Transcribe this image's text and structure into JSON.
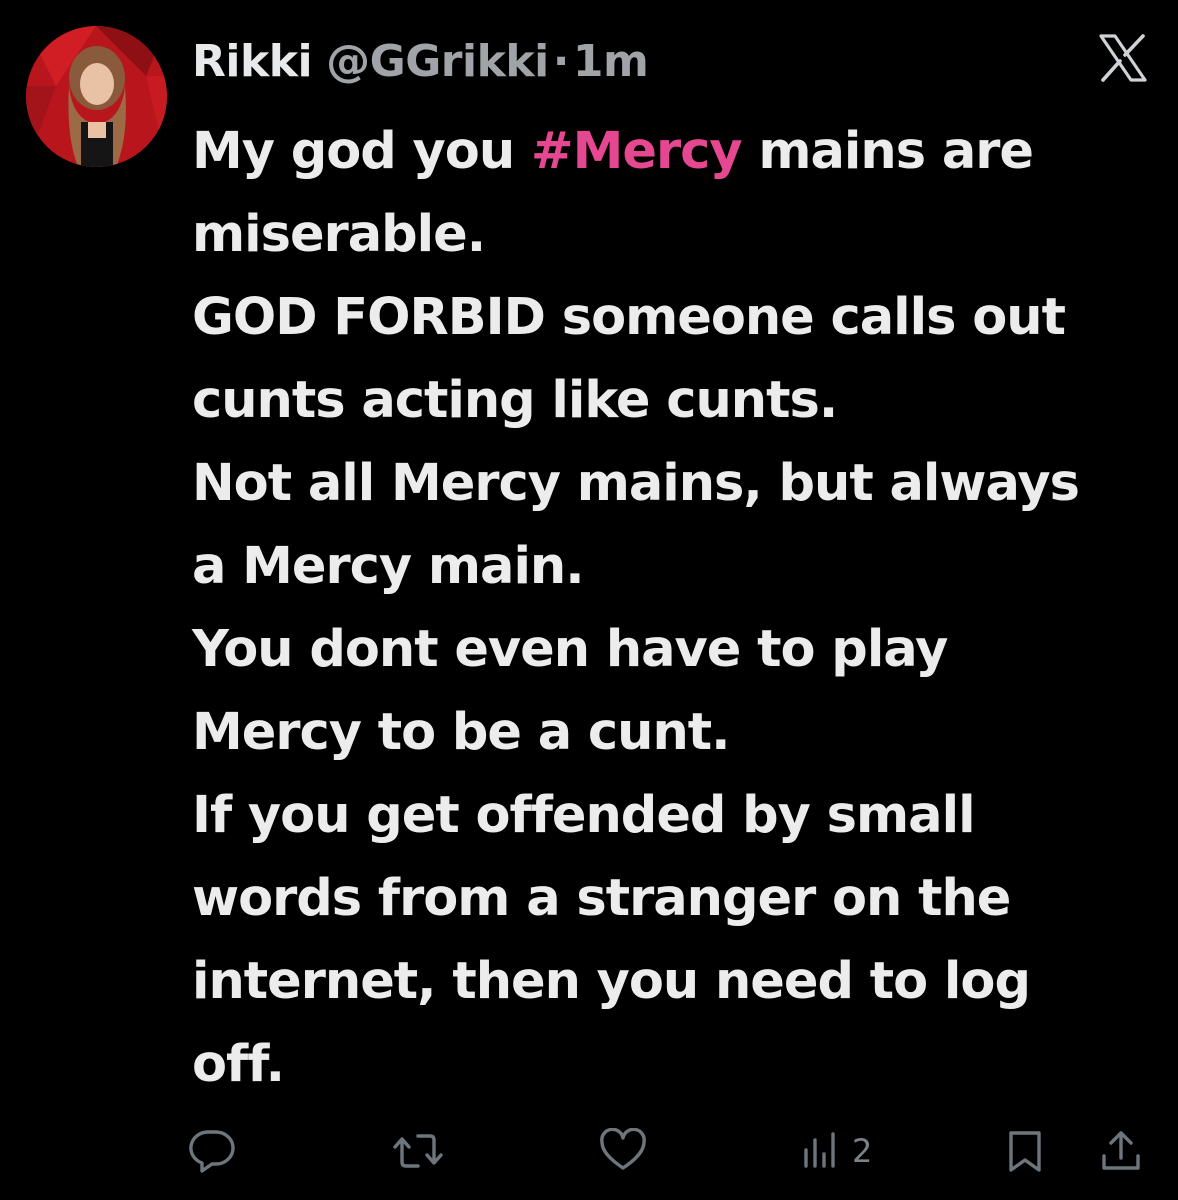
{
  "tweet": {
    "display_name": "Rikki",
    "handle": "@GGrikki",
    "separator": "·",
    "time": "1m",
    "lines": [
      {
        "parts": [
          "My god you ",
          "#Mercy",
          " mains are"
        ]
      },
      {
        "text": "miserable."
      },
      {
        "text": "GOD FORBID someone calls out"
      },
      {
        "text": "cunts acting like cunts."
      },
      {
        "text": "Not all Mercy mains, but always"
      },
      {
        "text": "a Mercy main."
      },
      {
        "text": "You dont even have to play"
      },
      {
        "text": "Mercy to be a cunt."
      },
      {
        "text": "If you get offended by small"
      },
      {
        "text": "words from a stranger on the"
      },
      {
        "text": "internet, then you need to log"
      },
      {
        "text": "off."
      }
    ]
  },
  "actions": {
    "reply_icon": "speech-bubble-icon",
    "retweet_icon": "retweet-icon",
    "like_icon": "heart-icon",
    "views_icon": "bar-chart-icon",
    "views_count": "2",
    "bookmark_icon": "bookmark-icon",
    "share_icon": "share-icon"
  },
  "brand": {
    "logo_icon": "x-logo-icon",
    "hashtag_color": "#e64791",
    "text_color": "#ececec",
    "muted_color": "#6e767d"
  }
}
